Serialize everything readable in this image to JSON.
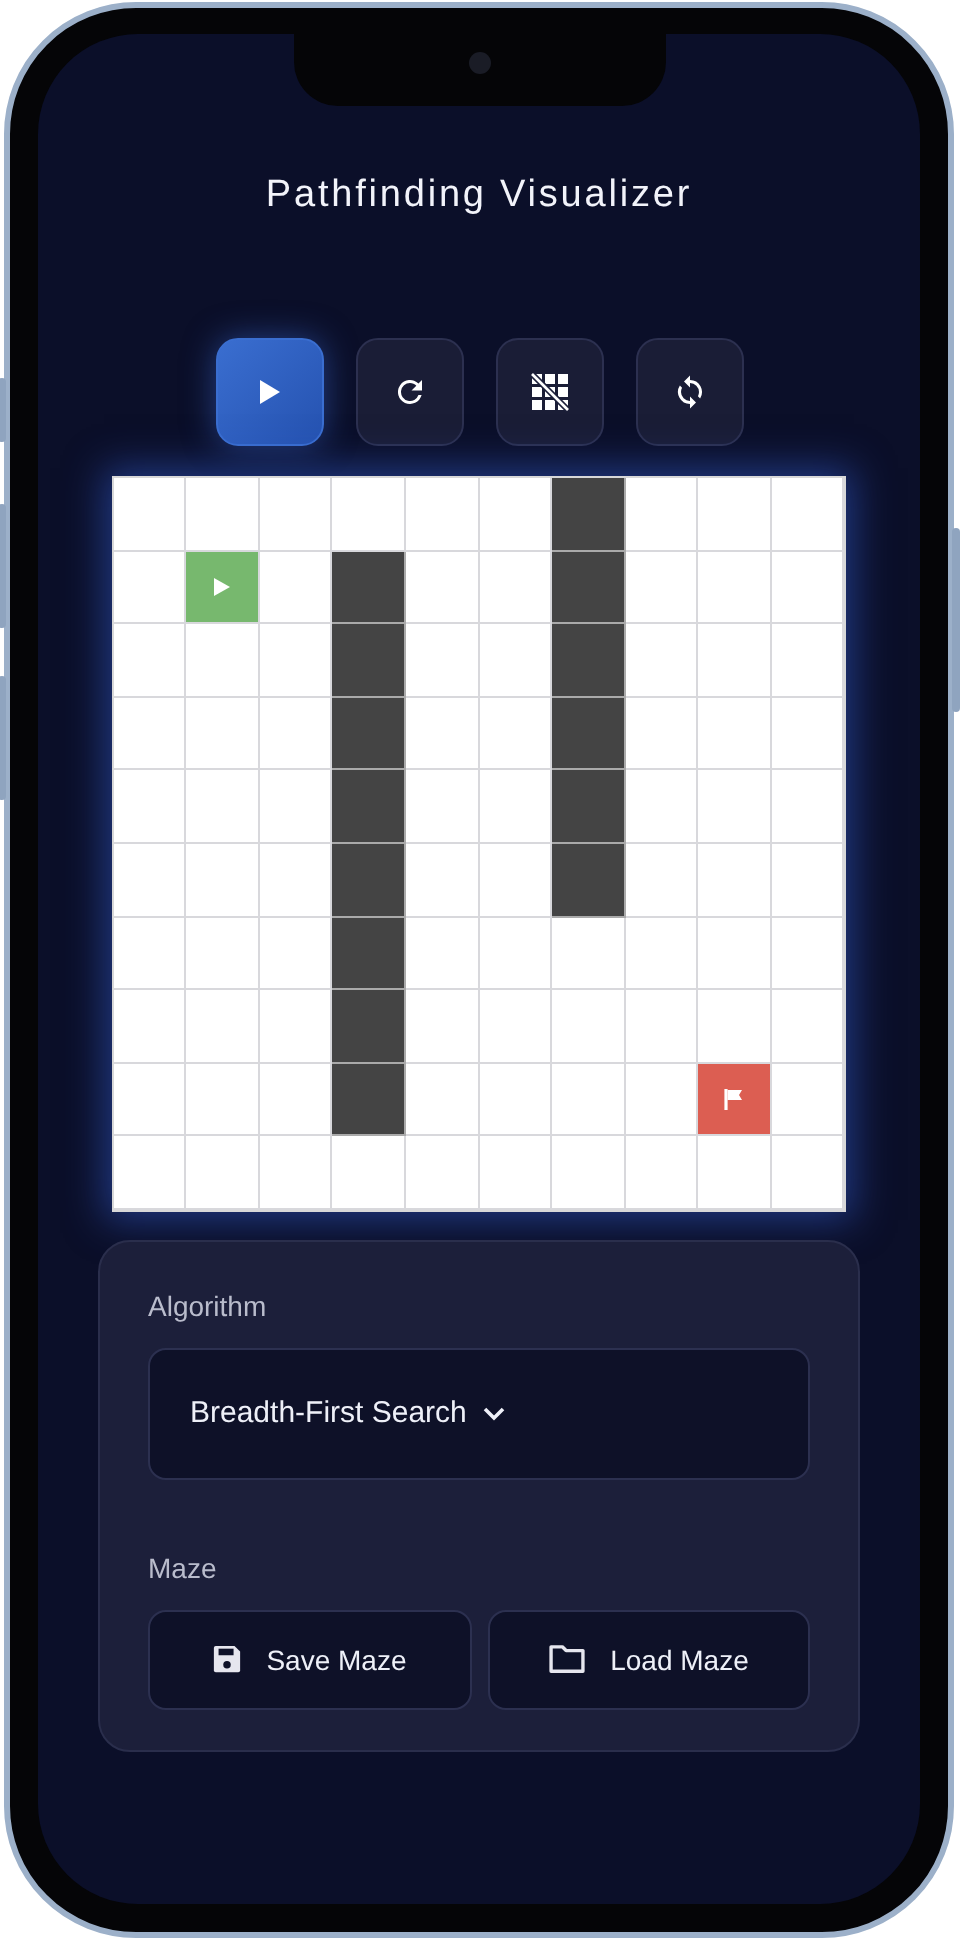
{
  "app": {
    "title": "Pathfinding Visualizer"
  },
  "toolbar": [
    {
      "kind": "play",
      "selected": true
    },
    {
      "kind": "refresh",
      "selected": false
    },
    {
      "kind": "grid-off",
      "selected": false
    },
    {
      "kind": "reset",
      "selected": false
    }
  ],
  "grid": {
    "rows": [
      [
        {
          "kind": "empty"
        },
        {
          "kind": "empty"
        },
        {
          "kind": "empty"
        },
        {
          "kind": "empty"
        },
        {
          "kind": "empty"
        },
        {
          "kind": "empty"
        },
        {
          "kind": "wall"
        },
        {
          "kind": "empty"
        },
        {
          "kind": "empty"
        },
        {
          "kind": "empty"
        }
      ],
      [
        {
          "kind": "empty"
        },
        {
          "kind": "start"
        },
        {
          "kind": "empty"
        },
        {
          "kind": "wall"
        },
        {
          "kind": "empty"
        },
        {
          "kind": "empty"
        },
        {
          "kind": "wall"
        },
        {
          "kind": "empty"
        },
        {
          "kind": "empty"
        },
        {
          "kind": "empty"
        }
      ],
      [
        {
          "kind": "empty"
        },
        {
          "kind": "empty"
        },
        {
          "kind": "empty"
        },
        {
          "kind": "wall"
        },
        {
          "kind": "empty"
        },
        {
          "kind": "empty"
        },
        {
          "kind": "wall"
        },
        {
          "kind": "empty"
        },
        {
          "kind": "empty"
        },
        {
          "kind": "empty"
        }
      ],
      [
        {
          "kind": "empty"
        },
        {
          "kind": "empty"
        },
        {
          "kind": "empty"
        },
        {
          "kind": "wall"
        },
        {
          "kind": "empty"
        },
        {
          "kind": "empty"
        },
        {
          "kind": "wall"
        },
        {
          "kind": "empty"
        },
        {
          "kind": "empty"
        },
        {
          "kind": "empty"
        }
      ],
      [
        {
          "kind": "empty"
        },
        {
          "kind": "empty"
        },
        {
          "kind": "empty"
        },
        {
          "kind": "wall"
        },
        {
          "kind": "empty"
        },
        {
          "kind": "empty"
        },
        {
          "kind": "wall"
        },
        {
          "kind": "empty"
        },
        {
          "kind": "empty"
        },
        {
          "kind": "empty"
        }
      ],
      [
        {
          "kind": "empty"
        },
        {
          "kind": "empty"
        },
        {
          "kind": "empty"
        },
        {
          "kind": "wall"
        },
        {
          "kind": "empty"
        },
        {
          "kind": "empty"
        },
        {
          "kind": "wall"
        },
        {
          "kind": "empty"
        },
        {
          "kind": "empty"
        },
        {
          "kind": "empty"
        }
      ],
      [
        {
          "kind": "empty"
        },
        {
          "kind": "empty"
        },
        {
          "kind": "empty"
        },
        {
          "kind": "wall"
        },
        {
          "kind": "empty"
        },
        {
          "kind": "empty"
        },
        {
          "kind": "empty"
        },
        {
          "kind": "empty"
        },
        {
          "kind": "empty"
        },
        {
          "kind": "empty"
        }
      ],
      [
        {
          "kind": "empty"
        },
        {
          "kind": "empty"
        },
        {
          "kind": "empty"
        },
        {
          "kind": "wall"
        },
        {
          "kind": "empty"
        },
        {
          "kind": "empty"
        },
        {
          "kind": "empty"
        },
        {
          "kind": "empty"
        },
        {
          "kind": "empty"
        },
        {
          "kind": "empty"
        }
      ],
      [
        {
          "kind": "empty"
        },
        {
          "kind": "empty"
        },
        {
          "kind": "empty"
        },
        {
          "kind": "wall"
        },
        {
          "kind": "empty"
        },
        {
          "kind": "empty"
        },
        {
          "kind": "empty"
        },
        {
          "kind": "empty"
        },
        {
          "kind": "end"
        },
        {
          "kind": "empty"
        }
      ],
      [
        {
          "kind": "empty"
        },
        {
          "kind": "empty"
        },
        {
          "kind": "empty"
        },
        {
          "kind": "empty"
        },
        {
          "kind": "empty"
        },
        {
          "kind": "empty"
        },
        {
          "kind": "empty"
        },
        {
          "kind": "empty"
        },
        {
          "kind": "empty"
        },
        {
          "kind": "empty"
        }
      ]
    ]
  },
  "settings": {
    "algorithm_label": "Algorithm",
    "algorithm": "Breadth-First Search",
    "maze_label": "Maze",
    "maze_buttons": [
      {
        "kind": "save",
        "label": "Save Maze"
      },
      {
        "kind": "load",
        "label": "Load Maze"
      }
    ]
  }
}
